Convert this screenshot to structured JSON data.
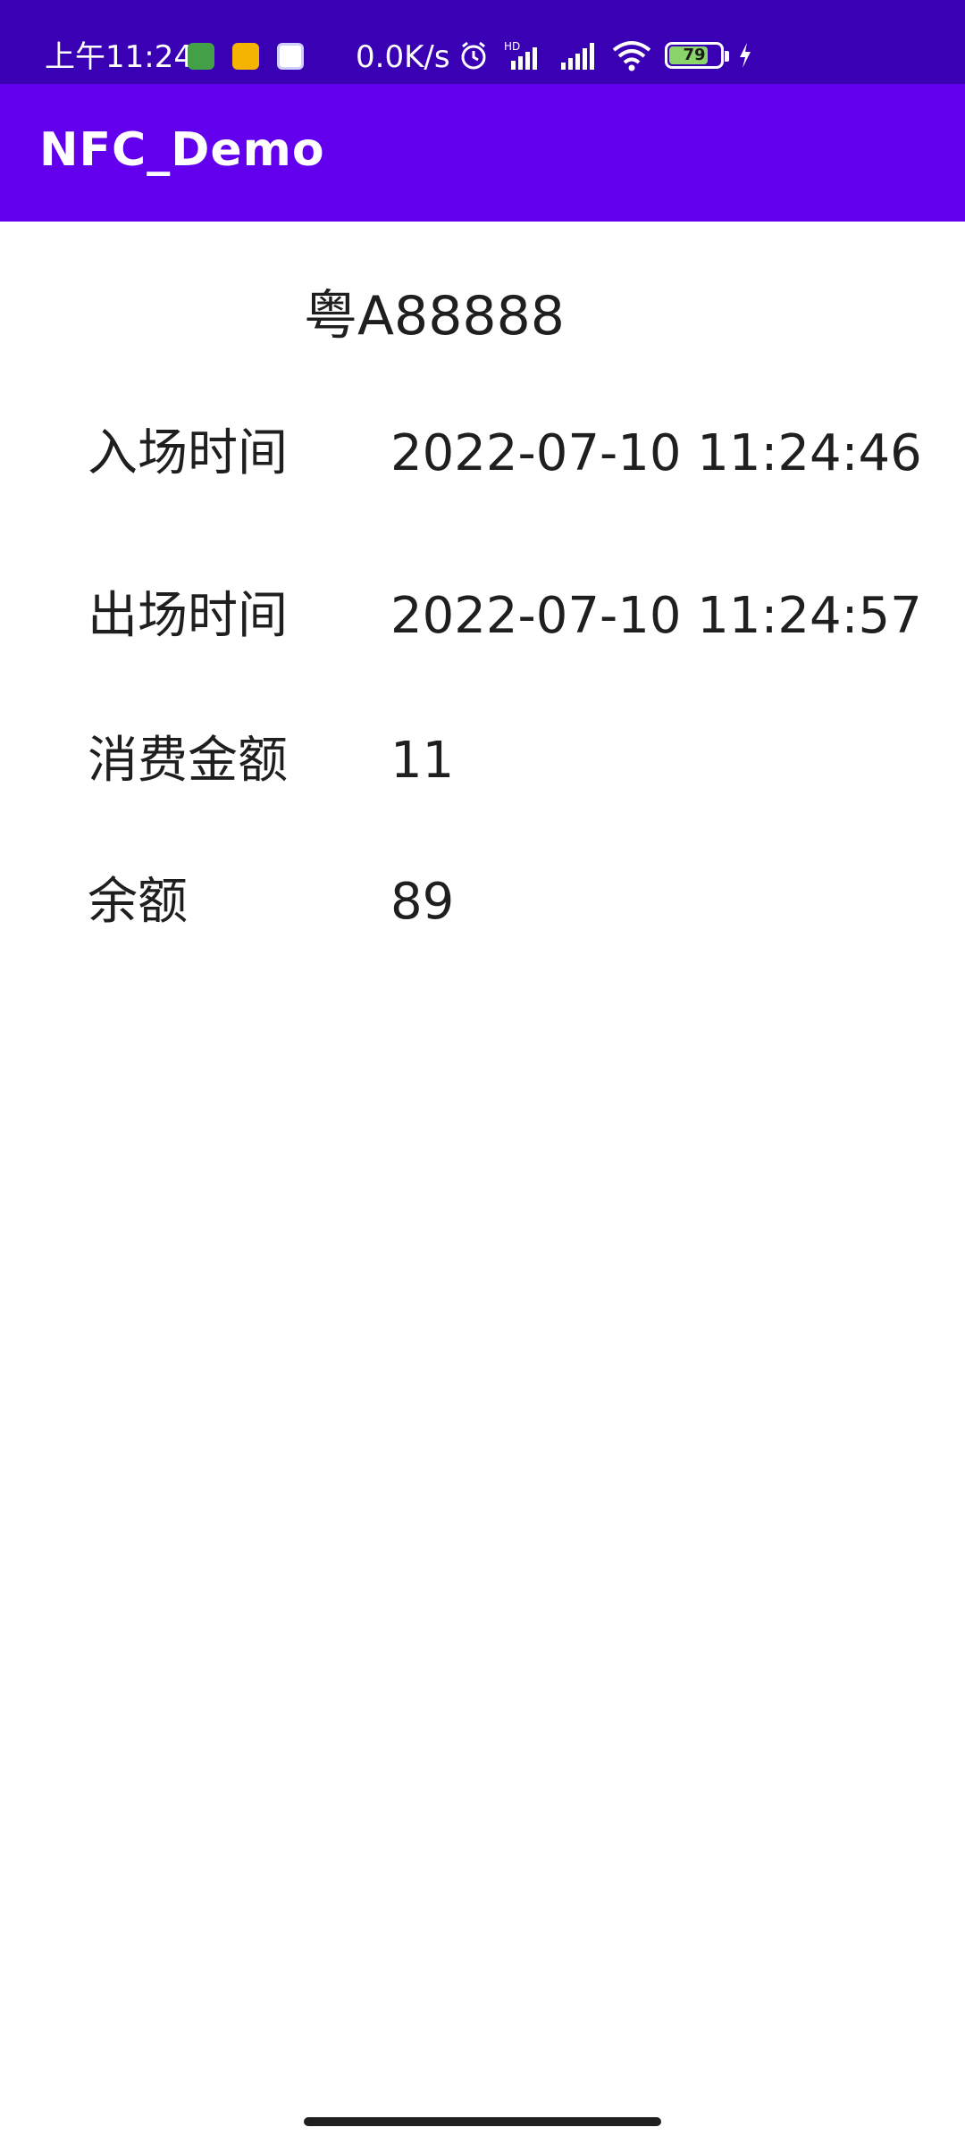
{
  "status_bar": {
    "time": "上午11:24",
    "net_speed": "0.0K/s",
    "battery_level": "79",
    "battery_fraction": 0.79,
    "icons": [
      "green-app-icon",
      "orange-app-icon",
      "purple-app-icon",
      "alarm-icon",
      "hd-signal-icon",
      "signal-icon",
      "wifi-icon",
      "battery-icon",
      "charging-icon"
    ]
  },
  "app_bar": {
    "title": "NFC_Demo"
  },
  "content": {
    "plate": "粤A88888",
    "rows": [
      {
        "label": "入场时间",
        "value": "2022-07-10 11:24:46"
      },
      {
        "label": "出场时间",
        "value": "2022-07-10 11:24:57"
      },
      {
        "label": "消费金额",
        "value": "11"
      },
      {
        "label": "余额",
        "value": "89"
      }
    ]
  },
  "colors": {
    "status_bar": "#3a00b3",
    "app_bar": "#6200ee",
    "text": "#1f1f1f"
  }
}
